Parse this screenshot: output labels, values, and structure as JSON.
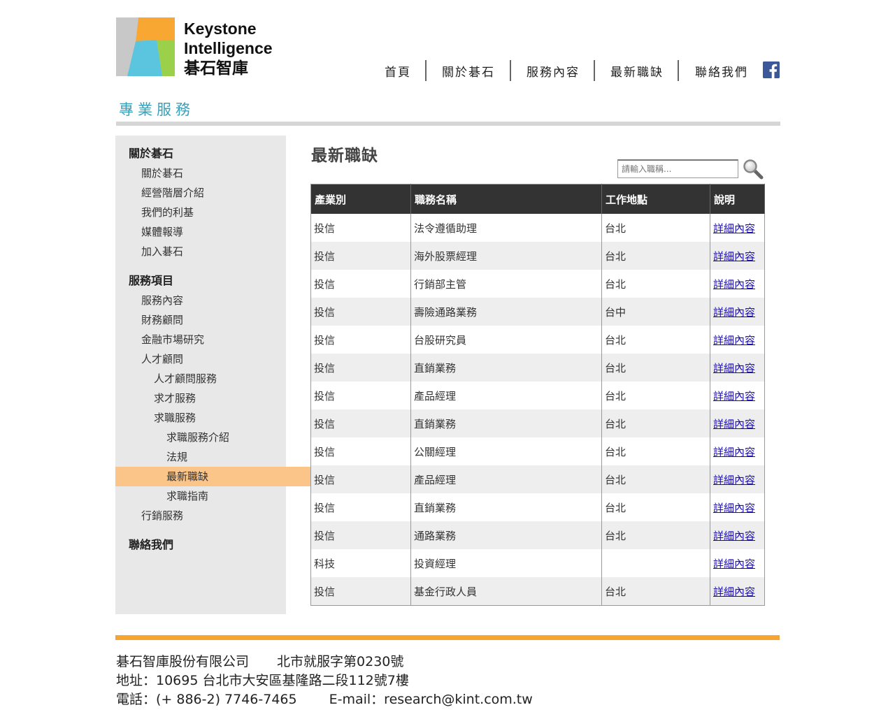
{
  "brand": {
    "line1": "Keystone",
    "line2": "Intelligence",
    "line3": "碁石智庫",
    "logo_colors": [
      "#c8c8c8",
      "#f8a832",
      "#9ad04a",
      "#5bc4de"
    ]
  },
  "nav": {
    "items": [
      "首頁",
      "關於碁石",
      "服務內容",
      "最新職缺",
      "聯絡我們"
    ],
    "social_icon": "facebook-icon"
  },
  "section_title": "專業服務",
  "sidebar": {
    "items": [
      {
        "label": "關於碁石",
        "type": "head"
      },
      {
        "label": "關於碁石",
        "type": "link"
      },
      {
        "label": "經營階層介紹",
        "type": "link"
      },
      {
        "label": "我們的利基",
        "type": "link"
      },
      {
        "label": "媒體報導",
        "type": "link"
      },
      {
        "label": "加入碁石",
        "type": "link"
      },
      {
        "label": "服務項目",
        "type": "head"
      },
      {
        "label": "服務內容",
        "type": "link"
      },
      {
        "label": "財務顧問",
        "type": "link"
      },
      {
        "label": "金融市場研究",
        "type": "link"
      },
      {
        "label": "人才顧問",
        "type": "link"
      },
      {
        "label": "人才顧問服務",
        "type": "link"
      },
      {
        "label": "求才服務",
        "type": "link"
      },
      {
        "label": "求職服務",
        "type": "link"
      },
      {
        "label": "求職服務介紹",
        "type": "link"
      },
      {
        "label": "法規",
        "type": "link"
      },
      {
        "label": "最新職缺",
        "type": "link",
        "active": true
      },
      {
        "label": "求職指南",
        "type": "link"
      },
      {
        "label": "行銷服務",
        "type": "link"
      },
      {
        "label": "聯絡我們",
        "type": "head"
      }
    ],
    "active_color": "#fbc58a"
  },
  "main": {
    "title": "最新職缺",
    "search": {
      "placeholder": "請輸入職稱...",
      "value": "",
      "icon": "magnifier-icon"
    },
    "table": {
      "headers": [
        "產業別",
        "職務名稱",
        "工作地點",
        "說明"
      ],
      "rows": [
        [
          "投信",
          "法令遵循助理",
          "台北",
          "詳細內容"
        ],
        [
          "投信",
          "海外股票經理",
          "台北",
          "詳細內容"
        ],
        [
          "投信",
          "行銷部主管",
          "台北",
          "詳細內容"
        ],
        [
          "投信",
          "壽險通路業務",
          "台中",
          "詳細內容"
        ],
        [
          "投信",
          "台股研究員",
          "台北",
          "詳細內容"
        ],
        [
          "投信",
          "直銷業務",
          "台北",
          "詳細內容"
        ],
        [
          "投信",
          "產品經理",
          "台北",
          "詳細內容"
        ],
        [
          "投信",
          "直銷業務",
          "台北",
          "詳細內容"
        ],
        [
          "投信",
          "公關經理",
          "台北",
          "詳細內容"
        ],
        [
          "投信",
          "產品經理",
          "台北",
          "詳細內容"
        ],
        [
          "投信",
          "直銷業務",
          "台北",
          "詳細內容"
        ],
        [
          "投信",
          "通路業務",
          "台北",
          "詳細內容"
        ],
        [
          "科技",
          "投資經理",
          "",
          "詳細內容"
        ],
        [
          "投信",
          "基金行政人員",
          "台北",
          "詳細內容"
        ]
      ]
    }
  },
  "footer": {
    "company": "碁石智庫股份有限公司",
    "license": "北市就服字第0230號",
    "address": "地址：10695 台北市大安區基隆路二段112號7樓",
    "phone": "電話：(+ 886-2) 7746-7465",
    "email": "E-mail：research@kint.com.tw",
    "accent_color": "#f5a530"
  }
}
